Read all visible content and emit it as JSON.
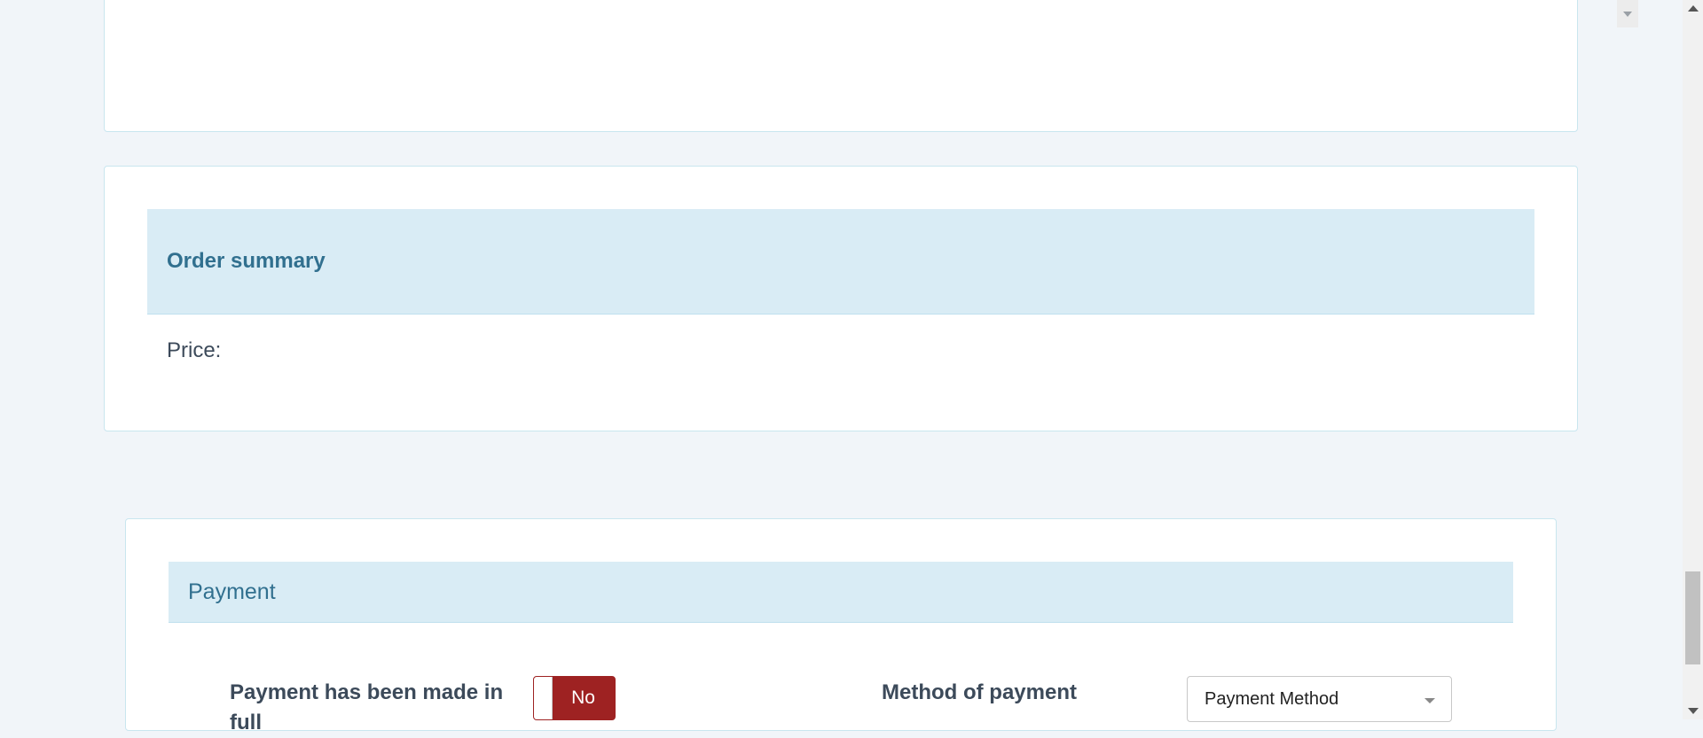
{
  "order_summary": {
    "title": "Order summary",
    "price_label": "Price:"
  },
  "payment": {
    "title": "Payment",
    "paid_in_full_label": "Payment has been made in full",
    "paid_in_full_toggle": "No",
    "method_label": "Method of payment",
    "method_select_value": "Payment Method"
  },
  "colors": {
    "heading_bg": "#d9ecf5",
    "heading_text": "#31708f",
    "toggle_off": "#9e2222"
  }
}
